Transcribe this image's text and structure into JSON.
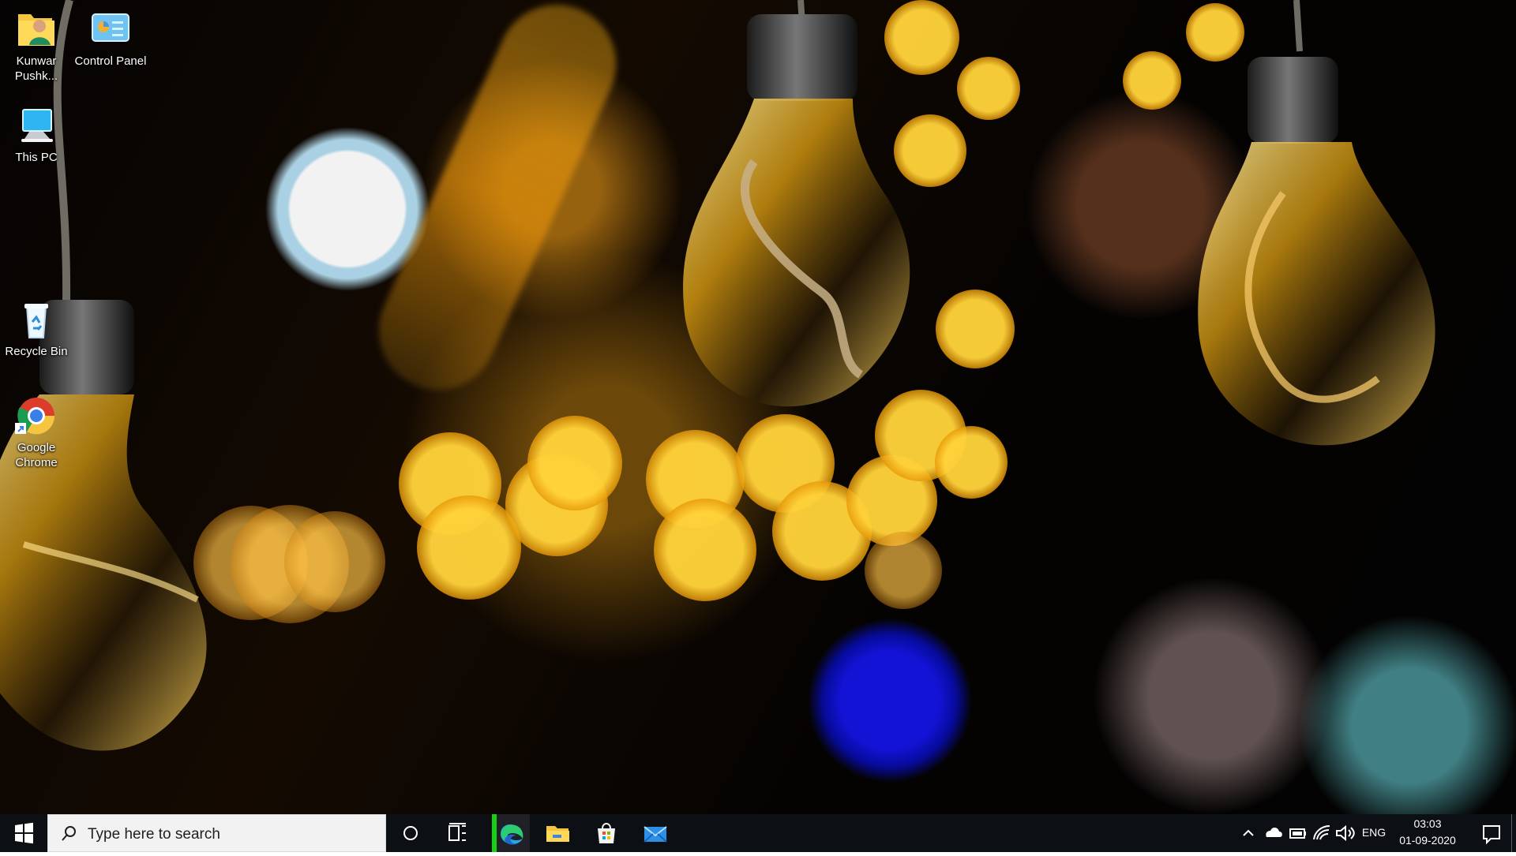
{
  "desktop": {
    "icons": [
      {
        "label": "Kunwar Pushk...",
        "icon": "user-folder-icon"
      },
      {
        "label": "Control Panel",
        "icon": "control-panel-icon"
      },
      {
        "label": "This PC",
        "icon": "computer-icon"
      },
      {
        "label": "Recycle Bin",
        "icon": "recycle-bin-icon"
      },
      {
        "label": "Google Chrome",
        "icon": "chrome-icon"
      }
    ]
  },
  "taskbar": {
    "search_placeholder": "Type here to search",
    "pinned": [
      {
        "name": "Cortana",
        "icon": "cortana-icon"
      },
      {
        "name": "Task View",
        "icon": "task-view-icon"
      },
      {
        "name": "Microsoft Edge",
        "icon": "edge-icon"
      },
      {
        "name": "File Explorer",
        "icon": "folder-icon"
      },
      {
        "name": "Microsoft Store",
        "icon": "store-icon"
      },
      {
        "name": "Mail",
        "icon": "mail-icon"
      }
    ],
    "tray": {
      "language": "ENG",
      "time": "03:03",
      "date": "01-09-2020",
      "icons": [
        "chevron-up-icon",
        "onedrive-cloud-icon",
        "battery-icon",
        "wifi-icon",
        "volume-icon",
        "notification-icon"
      ]
    }
  },
  "colors": {
    "taskbar": "#0c0f14",
    "active_app": "#16d116",
    "search_box": "#f2f2f2"
  }
}
